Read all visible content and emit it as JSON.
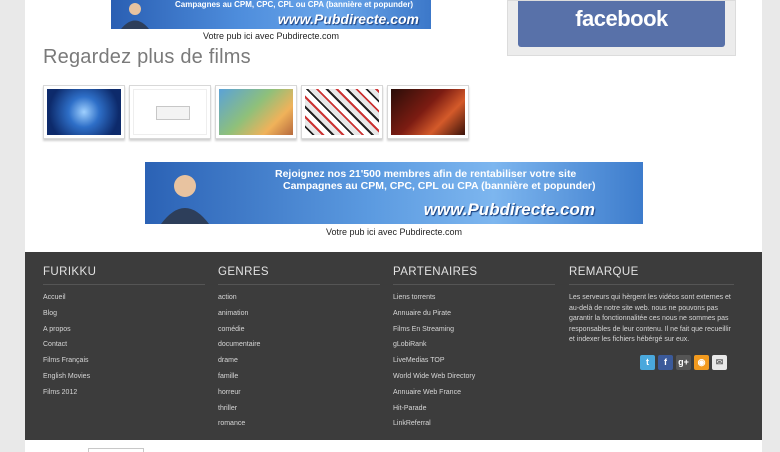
{
  "top_banner": {
    "line1": "Campagnes au CPM, CPC, CPL ou CPA (bannière et popunder)",
    "brand": "www.Pubdirecte.com",
    "caption": "Votre pub ici avec Pubdirecte.com"
  },
  "facebook_box": {
    "label": "facebook",
    "color": "#5871a9"
  },
  "section_title": "Regardez plus de films",
  "thumbnails": [
    {
      "alt": "film-thumbnail-1"
    },
    {
      "alt": "film-thumbnail-placeholder"
    },
    {
      "alt": "film-thumbnail-3"
    },
    {
      "alt": "film-thumbnail-4"
    },
    {
      "alt": "film-thumbnail-5"
    }
  ],
  "mid_banner": {
    "line1": "Rejoignez nos 21'500 membres afin de rentabiliser votre site",
    "line2": "Campagnes au CPM, CPC, CPL ou CPA (bannière et popunder)",
    "brand": "www.Pubdirecte.com",
    "caption": "Votre pub ici avec Pubdirecte.com"
  },
  "footer": {
    "furikku": {
      "title": "FURIKKU",
      "items": [
        "Accueil",
        "Blog",
        "A propos",
        "Contact",
        "Films Français",
        "English Movies",
        "Films 2012"
      ]
    },
    "genres": {
      "title": "GENRES",
      "items": [
        "action",
        "animation",
        "comédie",
        "documentaire",
        "drame",
        "famille",
        "horreur",
        "thriller",
        "romance"
      ]
    },
    "partenaires": {
      "title": "PARTENAIRES",
      "items": [
        "Liens torrents",
        "Annuaire du Pirate",
        "Films En Streaming",
        "gLobiRank",
        "LiveMedias TOP",
        "World Wide Web Directory",
        "Annuaire Web France",
        "Hit-Parade",
        "LinkReferral"
      ]
    },
    "remarque": {
      "title": "REMARQUE",
      "text": "Les serveurs qui hèrgent les vidéos sont externes et au-delà de notre site web. nous ne pouvons pas garantir la fonctionnalitée ces nous ne sommes pas responsables de leur contenu. Il ne fait que recueillir et indexer les fichiers hébérgé sur eux."
    },
    "social_icons": [
      {
        "name": "twitter-icon",
        "glyph": "t"
      },
      {
        "name": "facebook-icon",
        "glyph": "f"
      },
      {
        "name": "google-plus-icon",
        "glyph": "g+"
      },
      {
        "name": "rss-icon",
        "glyph": "◉"
      },
      {
        "name": "mail-icon",
        "glyph": "✉"
      }
    ]
  }
}
